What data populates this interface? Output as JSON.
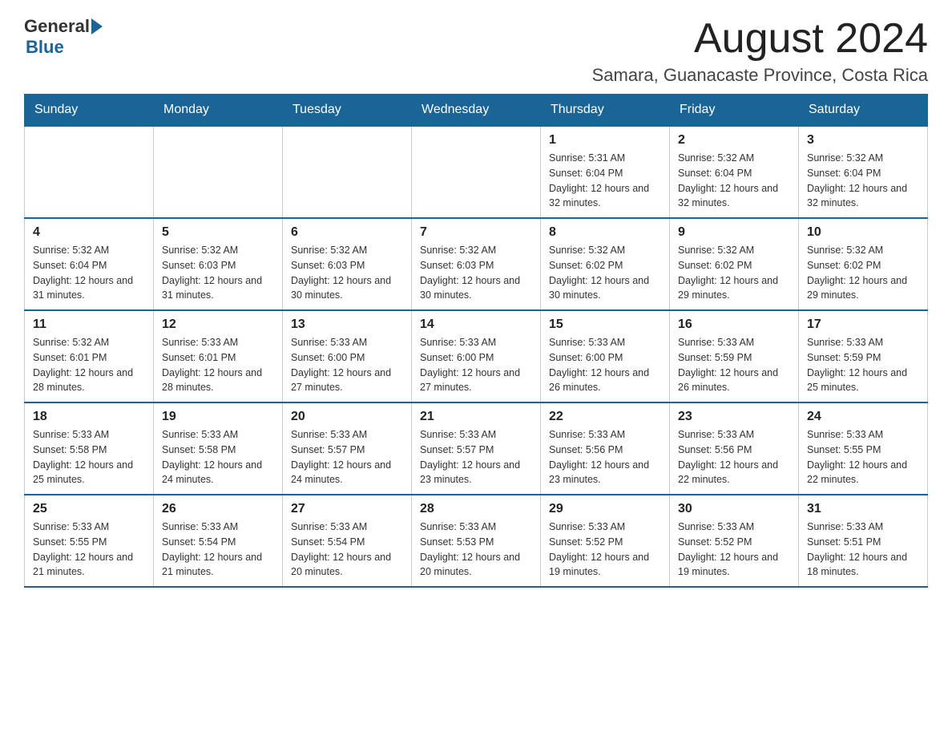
{
  "header": {
    "logo_general": "General",
    "logo_blue": "Blue",
    "month_year": "August 2024",
    "location": "Samara, Guanacaste Province, Costa Rica"
  },
  "days_of_week": [
    "Sunday",
    "Monday",
    "Tuesday",
    "Wednesday",
    "Thursday",
    "Friday",
    "Saturday"
  ],
  "weeks": [
    [
      {
        "day": "",
        "info": ""
      },
      {
        "day": "",
        "info": ""
      },
      {
        "day": "",
        "info": ""
      },
      {
        "day": "",
        "info": ""
      },
      {
        "day": "1",
        "info": "Sunrise: 5:31 AM\nSunset: 6:04 PM\nDaylight: 12 hours and 32 minutes."
      },
      {
        "day": "2",
        "info": "Sunrise: 5:32 AM\nSunset: 6:04 PM\nDaylight: 12 hours and 32 minutes."
      },
      {
        "day": "3",
        "info": "Sunrise: 5:32 AM\nSunset: 6:04 PM\nDaylight: 12 hours and 32 minutes."
      }
    ],
    [
      {
        "day": "4",
        "info": "Sunrise: 5:32 AM\nSunset: 6:04 PM\nDaylight: 12 hours and 31 minutes."
      },
      {
        "day": "5",
        "info": "Sunrise: 5:32 AM\nSunset: 6:03 PM\nDaylight: 12 hours and 31 minutes."
      },
      {
        "day": "6",
        "info": "Sunrise: 5:32 AM\nSunset: 6:03 PM\nDaylight: 12 hours and 30 minutes."
      },
      {
        "day": "7",
        "info": "Sunrise: 5:32 AM\nSunset: 6:03 PM\nDaylight: 12 hours and 30 minutes."
      },
      {
        "day": "8",
        "info": "Sunrise: 5:32 AM\nSunset: 6:02 PM\nDaylight: 12 hours and 30 minutes."
      },
      {
        "day": "9",
        "info": "Sunrise: 5:32 AM\nSunset: 6:02 PM\nDaylight: 12 hours and 29 minutes."
      },
      {
        "day": "10",
        "info": "Sunrise: 5:32 AM\nSunset: 6:02 PM\nDaylight: 12 hours and 29 minutes."
      }
    ],
    [
      {
        "day": "11",
        "info": "Sunrise: 5:32 AM\nSunset: 6:01 PM\nDaylight: 12 hours and 28 minutes."
      },
      {
        "day": "12",
        "info": "Sunrise: 5:33 AM\nSunset: 6:01 PM\nDaylight: 12 hours and 28 minutes."
      },
      {
        "day": "13",
        "info": "Sunrise: 5:33 AM\nSunset: 6:00 PM\nDaylight: 12 hours and 27 minutes."
      },
      {
        "day": "14",
        "info": "Sunrise: 5:33 AM\nSunset: 6:00 PM\nDaylight: 12 hours and 27 minutes."
      },
      {
        "day": "15",
        "info": "Sunrise: 5:33 AM\nSunset: 6:00 PM\nDaylight: 12 hours and 26 minutes."
      },
      {
        "day": "16",
        "info": "Sunrise: 5:33 AM\nSunset: 5:59 PM\nDaylight: 12 hours and 26 minutes."
      },
      {
        "day": "17",
        "info": "Sunrise: 5:33 AM\nSunset: 5:59 PM\nDaylight: 12 hours and 25 minutes."
      }
    ],
    [
      {
        "day": "18",
        "info": "Sunrise: 5:33 AM\nSunset: 5:58 PM\nDaylight: 12 hours and 25 minutes."
      },
      {
        "day": "19",
        "info": "Sunrise: 5:33 AM\nSunset: 5:58 PM\nDaylight: 12 hours and 24 minutes."
      },
      {
        "day": "20",
        "info": "Sunrise: 5:33 AM\nSunset: 5:57 PM\nDaylight: 12 hours and 24 minutes."
      },
      {
        "day": "21",
        "info": "Sunrise: 5:33 AM\nSunset: 5:57 PM\nDaylight: 12 hours and 23 minutes."
      },
      {
        "day": "22",
        "info": "Sunrise: 5:33 AM\nSunset: 5:56 PM\nDaylight: 12 hours and 23 minutes."
      },
      {
        "day": "23",
        "info": "Sunrise: 5:33 AM\nSunset: 5:56 PM\nDaylight: 12 hours and 22 minutes."
      },
      {
        "day": "24",
        "info": "Sunrise: 5:33 AM\nSunset: 5:55 PM\nDaylight: 12 hours and 22 minutes."
      }
    ],
    [
      {
        "day": "25",
        "info": "Sunrise: 5:33 AM\nSunset: 5:55 PM\nDaylight: 12 hours and 21 minutes."
      },
      {
        "day": "26",
        "info": "Sunrise: 5:33 AM\nSunset: 5:54 PM\nDaylight: 12 hours and 21 minutes."
      },
      {
        "day": "27",
        "info": "Sunrise: 5:33 AM\nSunset: 5:54 PM\nDaylight: 12 hours and 20 minutes."
      },
      {
        "day": "28",
        "info": "Sunrise: 5:33 AM\nSunset: 5:53 PM\nDaylight: 12 hours and 20 minutes."
      },
      {
        "day": "29",
        "info": "Sunrise: 5:33 AM\nSunset: 5:52 PM\nDaylight: 12 hours and 19 minutes."
      },
      {
        "day": "30",
        "info": "Sunrise: 5:33 AM\nSunset: 5:52 PM\nDaylight: 12 hours and 19 minutes."
      },
      {
        "day": "31",
        "info": "Sunrise: 5:33 AM\nSunset: 5:51 PM\nDaylight: 12 hours and 18 minutes."
      }
    ]
  ]
}
